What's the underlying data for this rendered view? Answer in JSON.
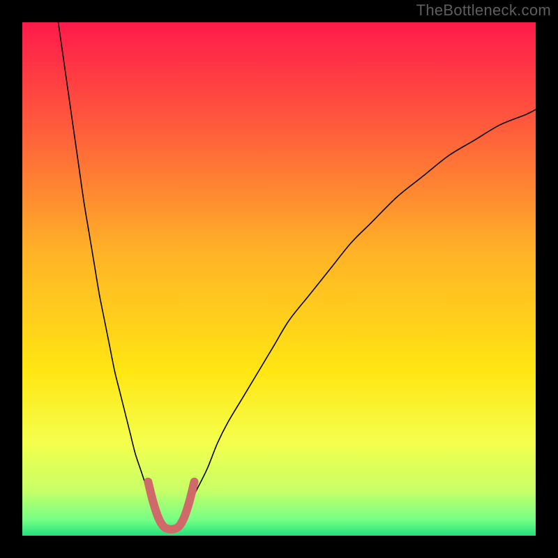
{
  "watermark": "TheBottleneck.com",
  "chart_data": {
    "type": "line",
    "title": "",
    "xlabel": "",
    "ylabel": "",
    "xlim": [
      0,
      100
    ],
    "ylim": [
      0,
      100
    ],
    "background_gradient": [
      {
        "stop": 0.0,
        "color": "#ff1a4b"
      },
      {
        "stop": 0.2,
        "color": "#ff5a3c"
      },
      {
        "stop": 0.45,
        "color": "#ffb327"
      },
      {
        "stop": 0.68,
        "color": "#ffe612"
      },
      {
        "stop": 0.82,
        "color": "#f4ff4d"
      },
      {
        "stop": 0.91,
        "color": "#c9ff66"
      },
      {
        "stop": 0.97,
        "color": "#74ff85"
      },
      {
        "stop": 1.0,
        "color": "#20e27a"
      }
    ],
    "series": [
      {
        "name": "curve-left",
        "color": "#000000",
        "width": 1.6,
        "x": [
          7,
          8,
          9,
          10,
          11,
          12,
          13,
          14,
          15,
          16,
          17,
          18,
          19,
          20,
          21,
          22,
          23,
          24,
          25,
          26
        ],
        "values": [
          100,
          93,
          86,
          79,
          72,
          65,
          59,
          53,
          47,
          42,
          37,
          32,
          28,
          24,
          20,
          16,
          13,
          10,
          7,
          5
        ]
      },
      {
        "name": "curve-right",
        "color": "#000000",
        "width": 1.6,
        "x": [
          32,
          34,
          36,
          38,
          40,
          43,
          46,
          49,
          52,
          56,
          60,
          64,
          68,
          73,
          78,
          83,
          88,
          93,
          98,
          100
        ],
        "values": [
          5,
          9,
          13,
          18,
          22,
          27,
          32,
          37,
          42,
          47,
          52,
          57,
          61,
          66,
          70,
          74,
          77,
          80,
          82,
          83
        ]
      },
      {
        "name": "u-highlight",
        "color": "#d06a6a",
        "width": 12,
        "linecap": "round",
        "x": [
          24.5,
          25.5,
          26.5,
          27.5,
          28.5,
          29.5,
          30.5,
          31.5,
          32.5,
          33.5
        ],
        "values": [
          10.5,
          6.5,
          3.5,
          1.8,
          1.3,
          1.3,
          1.8,
          3.5,
          6.5,
          10.5
        ]
      }
    ]
  }
}
